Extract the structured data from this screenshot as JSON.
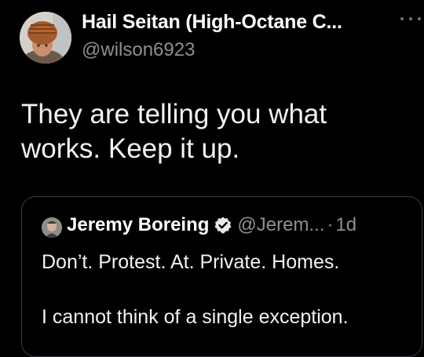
{
  "tweet": {
    "author": {
      "display_name": "Hail Seitan (High-Octane C...",
      "handle": "@wilson6923"
    },
    "more_icon": "more-horizontal-icon",
    "text_line1": "They are telling you what",
    "text_line2": "works. Keep it up.",
    "quoted": {
      "author_name": "Jeremy Boreing",
      "verified_icon": "verified-badge-icon",
      "handle": "@Jerem...",
      "separator": "·",
      "time": "1d",
      "text_line1": "Don’t. Protest. At. Private. Homes.",
      "text_line2": "I cannot think of a single exception."
    }
  },
  "colors": {
    "background": "#000000",
    "text_primary": "#f2f2f2",
    "text_secondary": "#8b9096",
    "border": "#3a3d41"
  }
}
